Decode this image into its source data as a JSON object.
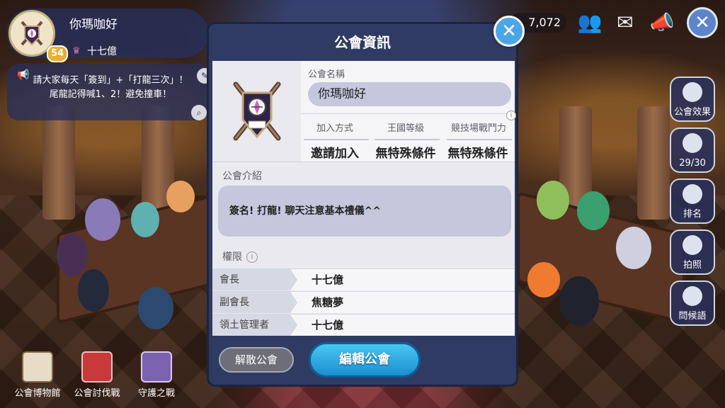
{
  "profile": {
    "guild_name": "你瑪咖好",
    "level": "54",
    "leader_name": "十七億"
  },
  "announcement": {
    "text": "請大家每天「簽到」+「打龍三次」！尾龍記得喊1、2！避免撞車！"
  },
  "top_bar": {
    "currency_value": "7,072"
  },
  "side_menu": {
    "guild_effect": "公會效果",
    "members": "29/30",
    "ranking": "排名",
    "photo": "拍照",
    "greeting": "問候語"
  },
  "bottom_menu": {
    "museum": "公會博物館",
    "raid": "公會討伐戰",
    "guard": "守護之戰"
  },
  "modal": {
    "title": "公會資訊",
    "guild_name_label": "公會名稱",
    "guild_name": "你瑪咖好",
    "join_method_label": "加入方式",
    "join_method": "邀請加入",
    "kingdom_level_label": "王國等級",
    "kingdom_level": "無特殊條件",
    "arena_power_label": "競技場戰鬥力",
    "arena_power": "無特殊條件",
    "intro_label": "公會介紹",
    "intro_text": "簽名! 打龍! 聊天注意基本禮儀^^",
    "permissions_label": "權限",
    "roles": [
      {
        "role": "會長",
        "member": "十七億"
      },
      {
        "role": "副會長",
        "member": "焦糖夢"
      },
      {
        "role": "領土管理者",
        "member": "十七億"
      }
    ],
    "disband_button": "解散公會",
    "edit_button": "編輯公會"
  }
}
